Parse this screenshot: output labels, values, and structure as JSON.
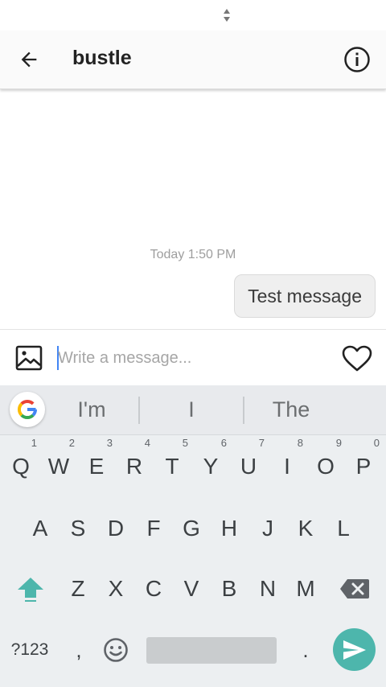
{
  "header": {
    "title": "bustle"
  },
  "conversation": {
    "timestamp": "Today 1:50 PM",
    "messages": [
      {
        "text": "Test message",
        "direction": "outgoing"
      }
    ]
  },
  "composer": {
    "placeholder": "Write a message..."
  },
  "keyboard": {
    "suggestions": [
      "I'm",
      "I",
      "The"
    ],
    "row1": [
      {
        "label": "Q",
        "hint": "1"
      },
      {
        "label": "W",
        "hint": "2"
      },
      {
        "label": "E",
        "hint": "3"
      },
      {
        "label": "R",
        "hint": "4"
      },
      {
        "label": "T",
        "hint": "5"
      },
      {
        "label": "Y",
        "hint": "6"
      },
      {
        "label": "U",
        "hint": "7"
      },
      {
        "label": "I",
        "hint": "8"
      },
      {
        "label": "O",
        "hint": "9"
      },
      {
        "label": "P",
        "hint": "0"
      }
    ],
    "row2": [
      "A",
      "S",
      "D",
      "F",
      "G",
      "H",
      "J",
      "K",
      "L"
    ],
    "row3": [
      "Z",
      "X",
      "C",
      "V",
      "B",
      "N",
      "M"
    ],
    "symbols_label": "?123",
    "comma_label": ",",
    "period_label": "."
  },
  "colors": {
    "accent": "#4db6ac",
    "cursor": "#4285f4",
    "bubble_bg": "#efefef"
  },
  "icons": [
    "sort-arrows-icon",
    "back-arrow-icon",
    "info-icon",
    "image-gallery-icon",
    "heart-icon",
    "google-g-icon",
    "shift-arrow-icon",
    "backspace-icon",
    "emoji-icon",
    "send-arrow-icon"
  ]
}
